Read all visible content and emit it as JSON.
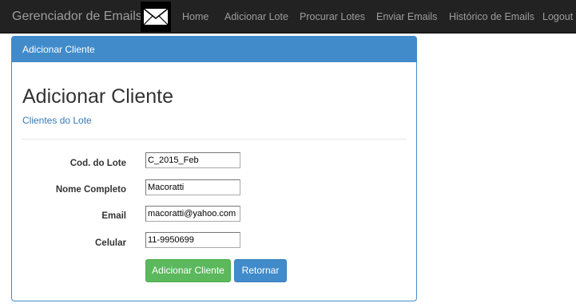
{
  "navbar": {
    "brand": "Gerenciador de Emails",
    "logo_icon": "envelope-icon",
    "items": [
      {
        "label": "Home"
      },
      {
        "label": "Adicionar Lote"
      },
      {
        "label": "Procurar Lotes"
      },
      {
        "label": "Enviar Emails"
      },
      {
        "label": "Histórico de Emails"
      },
      {
        "label": "Logout"
      }
    ]
  },
  "panel": {
    "heading": "Adicionar Cliente",
    "title": "Adicionar Cliente",
    "sub_link": "Clientes do Lote"
  },
  "form": {
    "fields": [
      {
        "label": "Cod. do Lote",
        "value": "C_2015_Feb"
      },
      {
        "label": "Nome Completo",
        "value": "Macoratti"
      },
      {
        "label": "Email",
        "value": "macoratti@yahoo.com"
      },
      {
        "label": "Celular",
        "value": "11-9950699"
      }
    ],
    "submit_label": "Adicionar Cliente",
    "back_label": "Retornar"
  },
  "colors": {
    "navbar_bg": "#222222",
    "primary": "#428bca",
    "success": "#5cb85c",
    "link": "#337ab7"
  }
}
